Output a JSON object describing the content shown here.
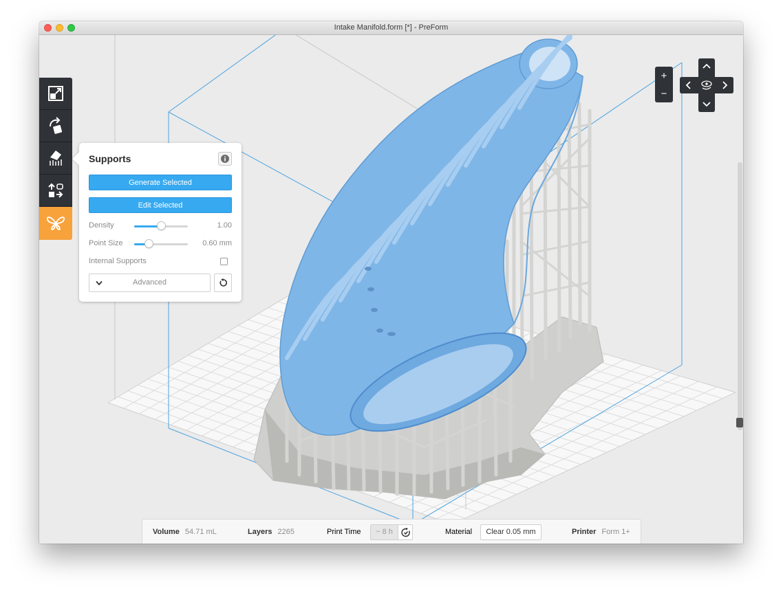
{
  "window": {
    "title": "Intake Manifold.form [*] - PreForm"
  },
  "toolbar": {
    "items": [
      {
        "name": "scale",
        "icon": "scale-icon"
      },
      {
        "name": "rotate",
        "icon": "rotate-icon"
      },
      {
        "name": "supports",
        "icon": "supports-icon"
      },
      {
        "name": "layout",
        "icon": "layout-icon"
      },
      {
        "name": "print",
        "icon": "butterfly-icon",
        "active": true
      }
    ]
  },
  "supports_panel": {
    "title": "Supports",
    "generate_selected": "Generate Selected",
    "edit_selected": "Edit Selected",
    "density_label": "Density",
    "density_value": "1.00",
    "density_level": 0.5,
    "point_size_label": "Point Size",
    "point_size_value": "0.60 mm",
    "point_size_level": 0.27,
    "internal_supports_label": "Internal Supports",
    "internal_supports_checked": false,
    "advanced_label": "Advanced"
  },
  "view_controls": {
    "zoom_in": "+",
    "zoom_out": "−"
  },
  "statusbar": {
    "volume_label": "Volume",
    "volume_value": "54.71 mL",
    "layers_label": "Layers",
    "layers_value": "2265",
    "print_time_label": "Print Time",
    "print_time_value": "~ 8 h",
    "material_label": "Material",
    "material_value": "Clear 0.05 mm",
    "printer_label": "Printer",
    "printer_value": "Form 1+"
  },
  "colors": {
    "model": "#7fb6e8",
    "supports": "#d2d3d0",
    "build_volume": "#4aa3e0",
    "accent_blue": "#36a9f0",
    "active_tool": "#f7a23b",
    "toolbar": "#2f3236"
  }
}
